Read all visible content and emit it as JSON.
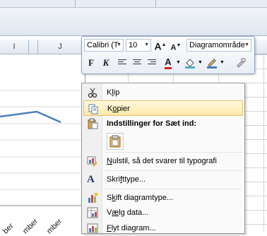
{
  "columns": [
    "I",
    "J"
  ],
  "mini_toolbar": {
    "font_name": "Calibri (T",
    "font_size": "10",
    "grow_font": "A",
    "shrink_font": "A",
    "element_select": "Diagramområde",
    "bold": "F",
    "italic": "K",
    "font_color_letter": "A"
  },
  "chart": {
    "x_labels": [
      "ber",
      "mber",
      "mber"
    ]
  },
  "menu": {
    "items": [
      {
        "label": "Klip",
        "icon": "scissors-icon"
      },
      {
        "label": "Kopier",
        "icon": "copy-icon"
      },
      {
        "label": "Indstillinger for Sæt ind:",
        "icon": "paste-icon"
      },
      {
        "label": "Nulstil, så det svarer til typografi",
        "icon": "reset-style-icon"
      },
      {
        "label": "Skrifttype...",
        "icon": "font-icon"
      },
      {
        "label": "Skift diagramtype...",
        "icon": "chart-type-icon"
      },
      {
        "label": "Vælg data...",
        "icon": "select-data-icon"
      },
      {
        "label": "Flyt diagram...",
        "icon": "move-chart-icon"
      }
    ]
  }
}
